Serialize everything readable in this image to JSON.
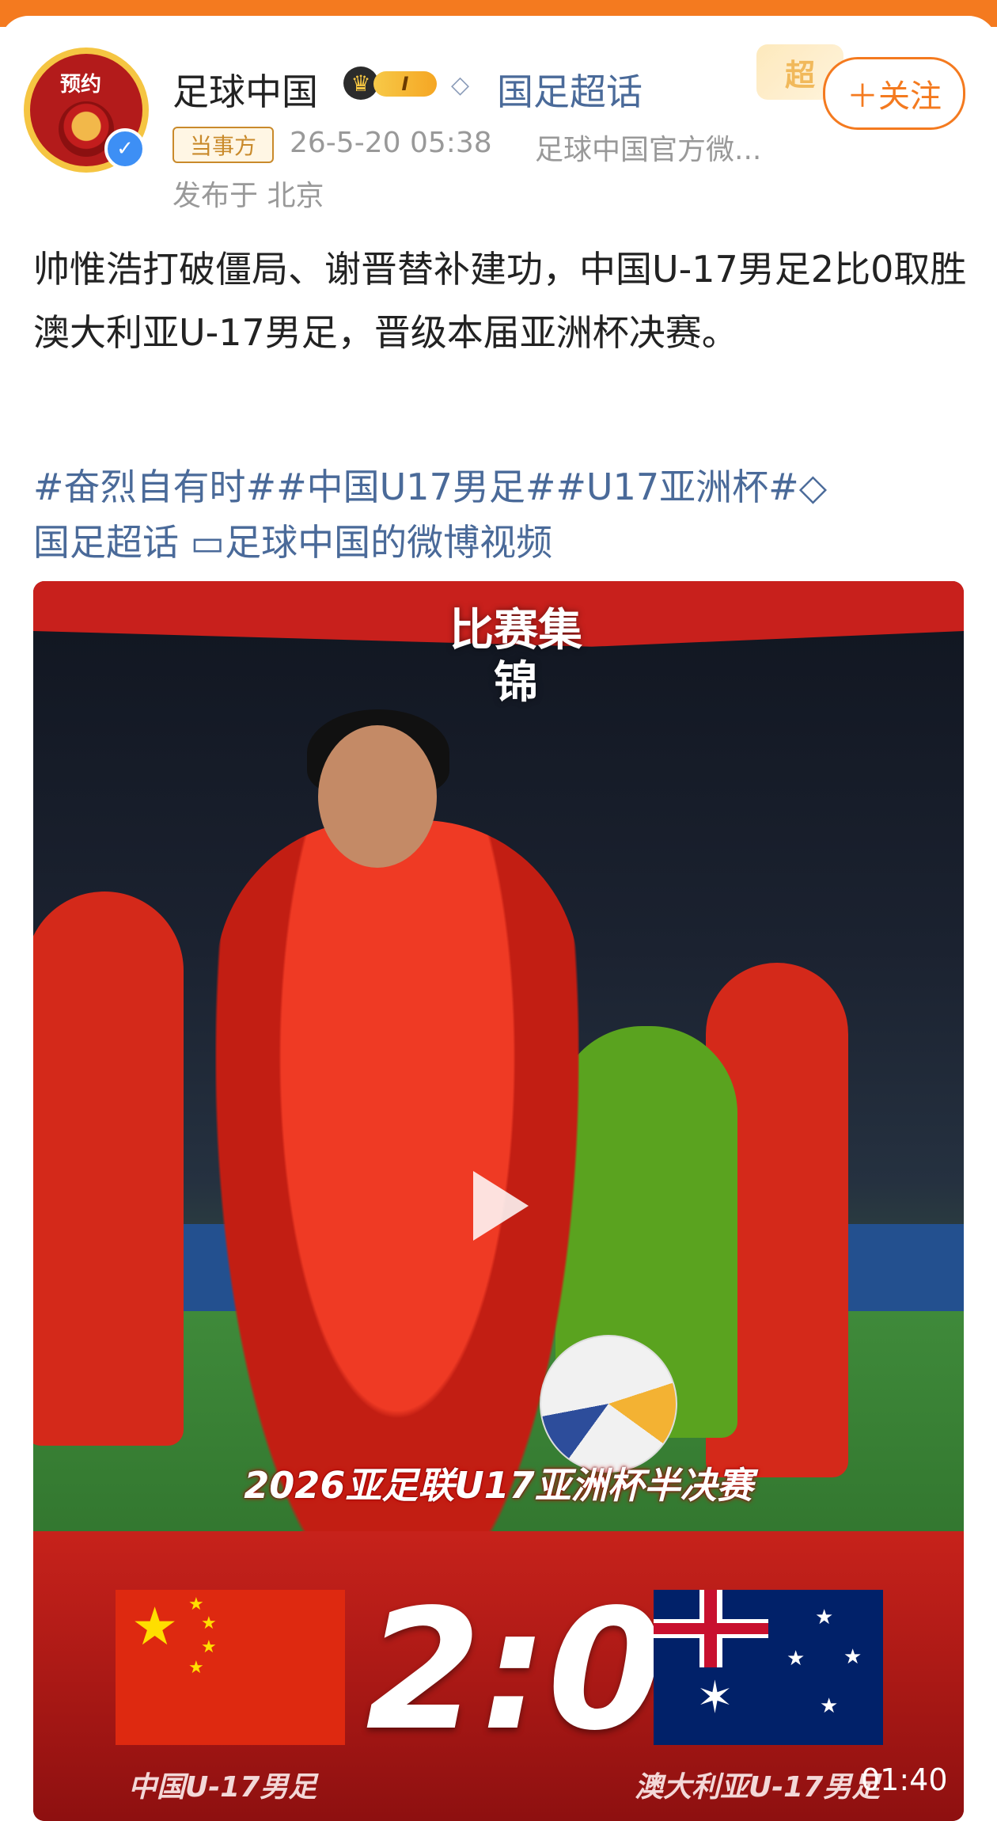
{
  "header": {
    "avatar_tag": "预约",
    "account_name": "足球中国",
    "level_badge": "I",
    "topic_link": "国足超话",
    "follow_label": "＋关注",
    "super_badge": "超",
    "meta_tag": "当事方",
    "time": "26-5-20 05:38",
    "source": "足球中国官方微...",
    "location": "发布于 北京"
  },
  "post": {
    "text": "帅惟浩打破僵局、谢晋替补建功，中国U-17男足2比0取胜澳大利亚U-17男足，晋级本届亚洲杯决赛。",
    "tags": [
      "#奋烈自有时#",
      "#中国U17男足#",
      "#U17亚洲杯#"
    ],
    "super_topic": "国足超话",
    "video_link": "足球中国的微博视频"
  },
  "video": {
    "title_badge": "比赛集锦",
    "match_caption": "2026亚足联U17亚洲杯半决赛",
    "score": "2:0",
    "team_left": "中国U-17男足",
    "team_right": "澳大利亚U-17男足",
    "duration": "01:40"
  },
  "colors": {
    "accent": "#f47a1f",
    "link": "#4a6a99",
    "meta": "#999999",
    "video_red": "#c8201c"
  }
}
